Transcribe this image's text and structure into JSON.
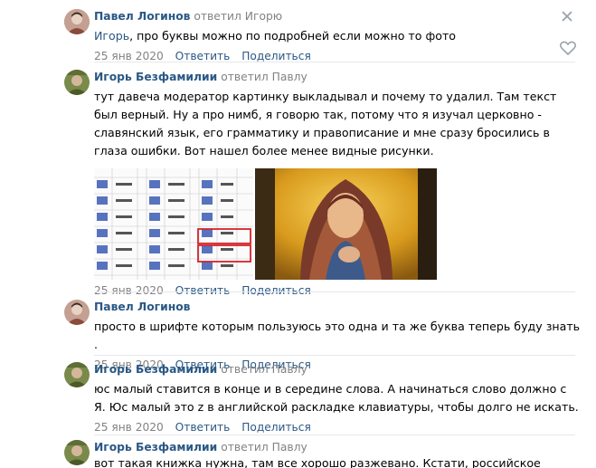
{
  "comments": [
    {
      "author": "Павел Логинов",
      "replied": "ответил Игорю",
      "mention": "Игорь",
      "text": ", про буквы можно по подробней если можно то фото",
      "date": "25 янв 2020",
      "reply": "Ответить",
      "share": "Поделиться"
    },
    {
      "author": "Игорь Безфамилии",
      "replied": "ответил Павлу",
      "text": "тут давеча модератор картинку выкладывал и почему то удалил. Там текст был верный. Ну а про нимб, я говорю так, потому что я изучал церковно - славянский язык, его грамматику и правописание и мне сразу бросились в глаза ошибки. Вот нашел более менее видные рисунки.",
      "date": "25 янв 2020",
      "reply": "Ответить",
      "share": "Поделиться"
    },
    {
      "author": "Павел Логинов",
      "text": "просто в шрифте которым пользуюсь это одна и та же буква теперь буду знать .",
      "date": "25 янв 2020",
      "reply": "Ответить",
      "share": "Поделиться"
    },
    {
      "author": "Игорь Безфамилии",
      "replied": "ответил Павлу",
      "text": "юс малый ставится в конце и в середине слова. А начинаться слово должно с Я. Юс малый это z в английской раскладке клавиатуры, чтобы долго не искать.",
      "date": "25 янв 2020",
      "reply": "Ответить",
      "share": "Поделиться"
    },
    {
      "author": "Игорь Безфамилии",
      "replied": "ответил Павлу",
      "text": "вот такая книжка нужна, там все хорошо разжевано. Кстати, российское"
    }
  ],
  "icons": {
    "close": "close-icon",
    "like": "heart-icon"
  },
  "colors": {
    "link": "#2a5885",
    "muted": "#828282",
    "separator": "#e7e8ec",
    "highlight_box": "#d6232b"
  }
}
